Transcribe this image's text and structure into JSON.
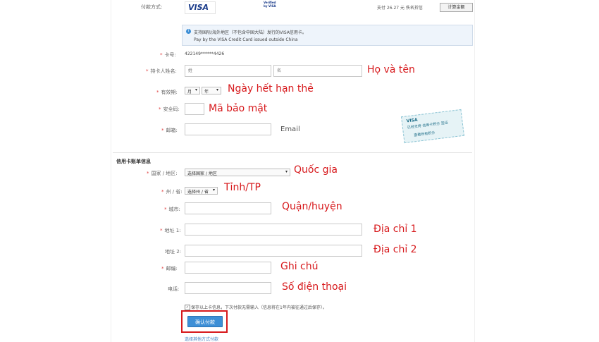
{
  "payment_method": {
    "label": "付款方式:",
    "visa_logo_text": "VISA",
    "verified_text": "Verified by VISA",
    "amount_text": "支付 26.27 元 佚名折信",
    "calculator_button": "计算金额"
  },
  "info_box": {
    "line1": "支持国际/海外地区（不包含中国大陆）发行的VISA信用卡。",
    "line2": "Pay by the VISA Credit Card issued outside China"
  },
  "form": {
    "card_number": {
      "label": "卡号:",
      "value": "422149******4426"
    },
    "cardholder": {
      "label": "持卡人姓名:",
      "first_placeholder": "姓",
      "last_placeholder": "名"
    },
    "expiry": {
      "label": "有效期:",
      "month": "月",
      "year": "年"
    },
    "cvv": {
      "label": "安全码:"
    },
    "email": {
      "label": "邮箱:"
    }
  },
  "visa_badge": {
    "text": "已经支持 信用卡积分 签证",
    "sub": "查看所有积分"
  },
  "billing": {
    "section_title": "信用卡账单信息",
    "country": {
      "label": "国家 / 地区:",
      "value": "选择国家 / 地区"
    },
    "province": {
      "label": "州 / 省:",
      "value": "选择州 / 省"
    },
    "city": {
      "label": "城市:"
    },
    "address1": {
      "label": "地址 1:"
    },
    "address2": {
      "label": "地址 2:"
    },
    "postal": {
      "label": "邮编:"
    },
    "phone": {
      "label": "电话:"
    },
    "save_info": "保存以上卡信息，下次付款无需输入（信息将在1年内被征通过后保存）。",
    "confirm_button": "确认付款",
    "other_methods_link": "选择其他方式付款"
  },
  "annotations": {
    "name": "Họ và tên",
    "expiry": "Ngày hết hạn thẻ",
    "cvv": "Mã bảo mật",
    "email": "Email",
    "country": "Quốc gia",
    "province": "Tỉnh/TP",
    "city": "Quận/huyện",
    "address1": "Địa chỉ 1",
    "address2": "Địa chỉ 2",
    "postal": "Ghi chú",
    "phone": "Số điện thoại"
  },
  "colors": {
    "annotation": "#d7191c",
    "button": "#3d8fd6",
    "info_bg": "#eef4fb"
  }
}
